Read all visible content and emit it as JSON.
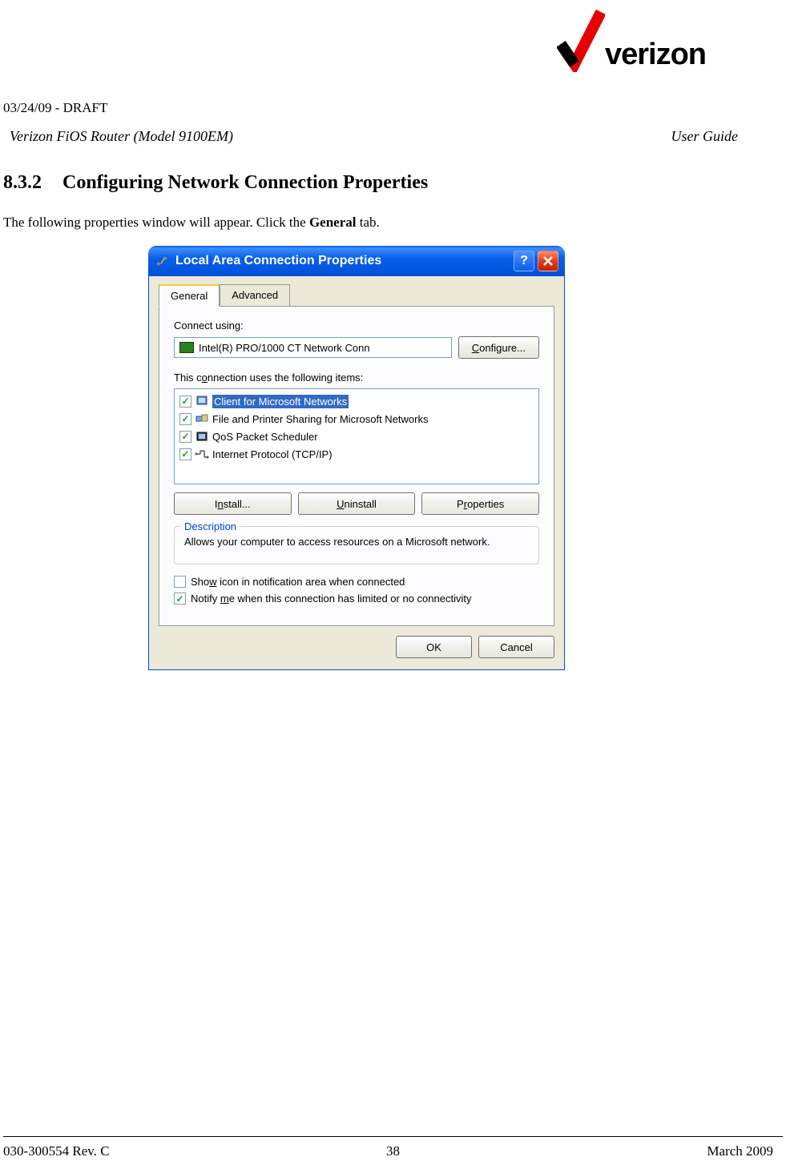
{
  "header": {
    "draft": "03/24/09 - DRAFT",
    "model": "Verizon FiOS Router (Model 9100EM)",
    "guide": "User Guide",
    "logo_text": "verizon"
  },
  "section": {
    "number": "8.3.2",
    "title": "Configuring Network Connection Properties"
  },
  "body": {
    "intro_pre": "The following properties window will appear. Click the ",
    "intro_bold": "General",
    "intro_post": " tab."
  },
  "dialog": {
    "title": "Local Area Connection Properties",
    "tabs": {
      "general": "General",
      "advanced": "Advanced"
    },
    "connect_using_label": "Connect using:",
    "adapter": "Intel(R) PRO/1000 CT Network Conn",
    "configure_btn": "Configure...",
    "items_label": "This connection uses the following items:",
    "items": [
      {
        "label": "Client for Microsoft Networks",
        "checked": true,
        "selected": true
      },
      {
        "label": "File and Printer Sharing for Microsoft Networks",
        "checked": true,
        "selected": false
      },
      {
        "label": "QoS Packet Scheduler",
        "checked": true,
        "selected": false
      },
      {
        "label": "Internet Protocol (TCP/IP)",
        "checked": true,
        "selected": false
      }
    ],
    "install_btn": "Install...",
    "uninstall_btn": "Uninstall",
    "properties_btn": "Properties",
    "description_legend": "Description",
    "description_text": "Allows your computer to access resources on a Microsoft network.",
    "show_icon_label": "Show icon in notification area when connected",
    "show_icon_checked": false,
    "notify_label": "Notify me when this connection has limited or no connectivity",
    "notify_checked": true,
    "ok_btn": "OK",
    "cancel_btn": "Cancel"
  },
  "footer": {
    "rev": "030-300554 Rev. C",
    "page": "38",
    "date": "March 2009"
  }
}
